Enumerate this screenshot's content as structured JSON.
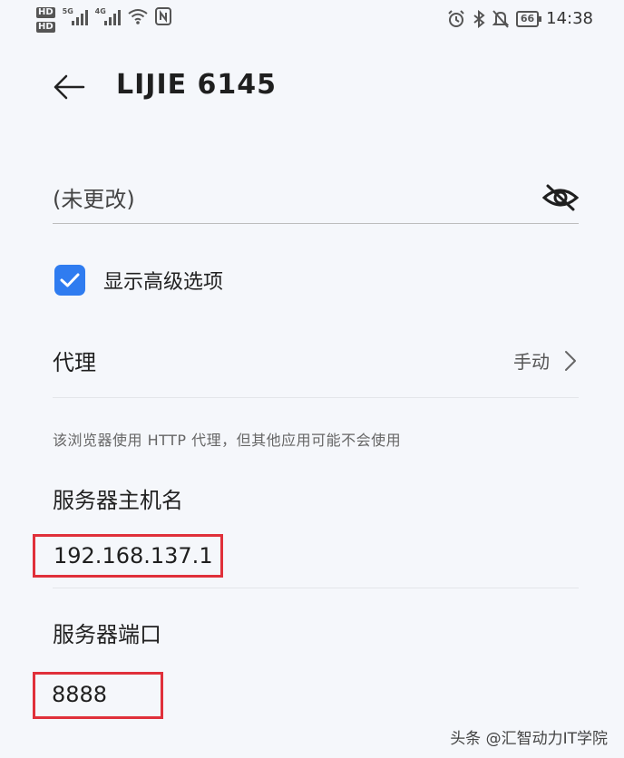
{
  "status_bar": {
    "hd_badges": [
      "HD",
      "HD"
    ],
    "sim1_gen": "5G",
    "sim2_gen": "4G",
    "battery": "66",
    "time": "14:38",
    "icons": [
      "alarm-icon",
      "bluetooth-icon",
      "mute-icon",
      "nfc-icon",
      "wifi-icon"
    ]
  },
  "header": {
    "title": "LIJIE 6145"
  },
  "password": {
    "value": "(未更改)",
    "visibility_icon": "eye-off-icon"
  },
  "advanced": {
    "checked": true,
    "label": "显示高级选项"
  },
  "proxy": {
    "label": "代理",
    "value": "手动"
  },
  "note": "该浏览器使用 HTTP 代理，但其他应用可能不会使用",
  "host": {
    "label": "服务器主机名",
    "value": "192.168.137.1"
  },
  "port": {
    "label": "服务器端口",
    "value": "8888"
  },
  "watermark": "头条 @汇智动力IT学院",
  "colors": {
    "accent": "#2f7cf0",
    "highlight_box": "#e0303a",
    "background": "#f5f7fb"
  }
}
